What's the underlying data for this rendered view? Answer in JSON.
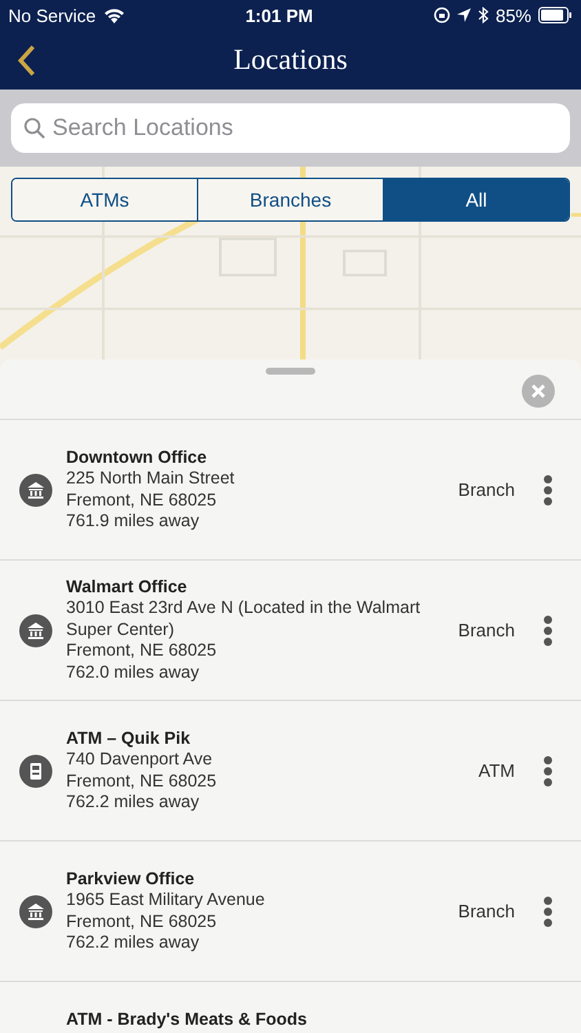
{
  "status_bar": {
    "carrier": "No Service",
    "time": "1:01 PM",
    "battery": "85%"
  },
  "header": {
    "title": "Locations"
  },
  "search": {
    "placeholder": "Search Locations"
  },
  "filter_tabs": [
    {
      "label": "ATMs",
      "selected": false
    },
    {
      "label": "Branches",
      "selected": false
    },
    {
      "label": "All",
      "selected": true
    }
  ],
  "locations": [
    {
      "kind": "branch",
      "name": "Downtown Office",
      "address": "225 North Main Street",
      "city": "Fremont, NE 68025",
      "distance": "761.9 miles away",
      "type": "Branch"
    },
    {
      "kind": "branch",
      "name": "Walmart Office",
      "address": "3010 East 23rd Ave N (Located in the Walmart Super Center)",
      "city": "Fremont, NE 68025",
      "distance": "762.0 miles away",
      "type": "Branch"
    },
    {
      "kind": "atm",
      "name": "ATM – Quik Pik",
      "address": "740 Davenport Ave",
      "city": "Fremont, NE 68025",
      "distance": "762.2 miles away",
      "type": "ATM"
    },
    {
      "kind": "branch",
      "name": "Parkview Office",
      "address": "1965 East Military Avenue",
      "city": "Fremont, NE 68025",
      "distance": "762.2 miles away",
      "type": "Branch"
    },
    {
      "name": "ATM - Brady's Meats & Foods"
    }
  ]
}
